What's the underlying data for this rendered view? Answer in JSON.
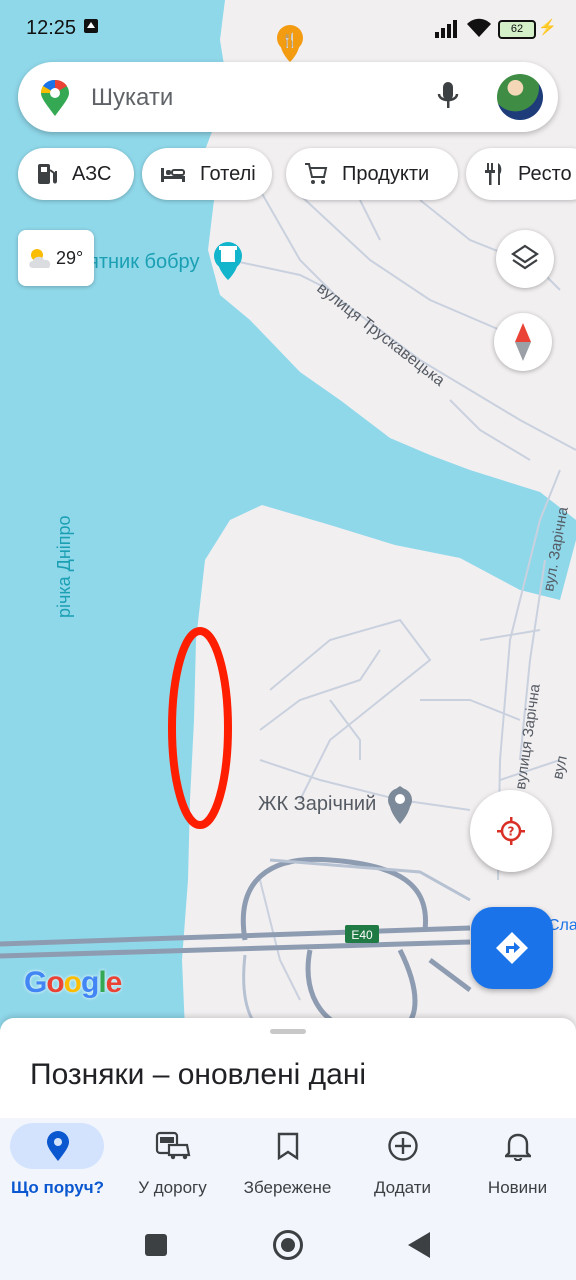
{
  "status_bar": {
    "time": "12:25",
    "battery": "62"
  },
  "search": {
    "placeholder": "Шукати"
  },
  "chips": [
    {
      "icon": "gas-station-icon",
      "label": "АЗС"
    },
    {
      "icon": "hotel-bed-icon",
      "label": "Готелі"
    },
    {
      "icon": "cart-icon",
      "label": "Продукти"
    },
    {
      "icon": "restaurant-icon",
      "label": "Ресто"
    }
  ],
  "weather": {
    "temp": "29°",
    "icon": "partly-cloudy-icon"
  },
  "map_labels": {
    "beaver_monument": "ятник бобру",
    "truskavetska": "вулиця Трускавецька",
    "dnipro": "річка Дніпро",
    "zarichna_short": "вул. Зарічна",
    "zarichna": "вулиця Зарічна",
    "zarichna_right": "вул",
    "zk_zarichnyi": "ЖК Зарічний",
    "e40": "E40",
    "sla": "Сла"
  },
  "google_logo": "Google",
  "bottom_sheet": {
    "title": "Позняки – оновлені дані"
  },
  "nav": [
    {
      "label": "Що поруч?",
      "icon": "location-pin-icon",
      "active": true
    },
    {
      "label": "У дорогу",
      "icon": "commute-icon",
      "active": false
    },
    {
      "label": "Збережене",
      "icon": "bookmark-icon",
      "active": false
    },
    {
      "label": "Додати",
      "icon": "add-circle-icon",
      "active": false
    },
    {
      "label": "Новини",
      "icon": "bell-icon",
      "active": false
    }
  ],
  "colors": {
    "water": "#8fd8ea",
    "land": "#f2eff1",
    "road": "#c9d1de",
    "highway": "#8e9cb2",
    "accent": "#1a73e8",
    "highlight": "#ff1e00"
  }
}
